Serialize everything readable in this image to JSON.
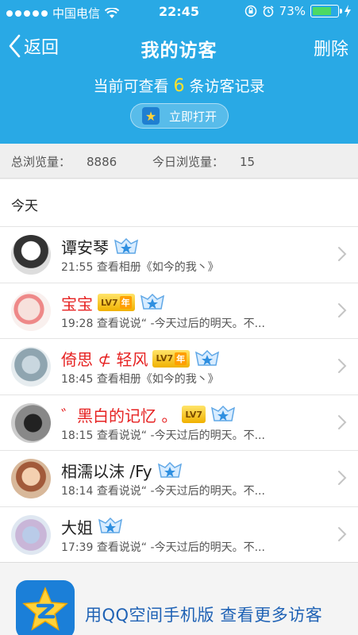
{
  "status_bar": {
    "carrier": "中国电信",
    "time": "22:45",
    "battery_percent": "73%",
    "battery_level": 0.73
  },
  "nav": {
    "back_label": "返回",
    "title": "我的访客",
    "delete_label": "删除"
  },
  "summary": {
    "prefix": "当前可查看",
    "count": "6",
    "suffix": "条访客记录",
    "open_button": "立即打开"
  },
  "stats": {
    "total_label": "总浏览量：",
    "total_value": "8886",
    "today_label": "今日浏览量：",
    "today_value": "15"
  },
  "section_title": "今天",
  "visitors": [
    {
      "name": "谭安琴",
      "red": false,
      "level": "",
      "time": "21:55",
      "action": "查看相册《如今的我丶》"
    },
    {
      "name": "宝宝",
      "red": true,
      "level": "LV7",
      "level_year": "年",
      "time": "19:28",
      "action": "查看说说“ -今天过后的明天。不..."
    },
    {
      "name": "倚思 ⊄ 轻风",
      "red": true,
      "level": "LV7",
      "level_year": "年",
      "time": "18:45",
      "action": "查看相册《如今的我丶》"
    },
    {
      "name": "゛黑白的记忆 。",
      "red": true,
      "level": "LV7",
      "level_year": "",
      "time": "18:15",
      "action": "查看说说“ -今天过后的明天。不..."
    },
    {
      "name": "相濡以沫 /Fy",
      "red": false,
      "level": "",
      "time": "18:14",
      "action": "查看说说“ -今天过后的明天。不..."
    },
    {
      "name": "大姐",
      "red": false,
      "level": "",
      "time": "17:39",
      "action": "查看说说“ -今天过后的明天。不..."
    }
  ],
  "banner": {
    "text": "用QQ空间手机版  查看更多访客"
  },
  "colors": {
    "header_blue": "#29a9e5",
    "count_yellow": "#ffe22b",
    "vip_red": "#e62222",
    "banner_text": "#1f62b5"
  }
}
